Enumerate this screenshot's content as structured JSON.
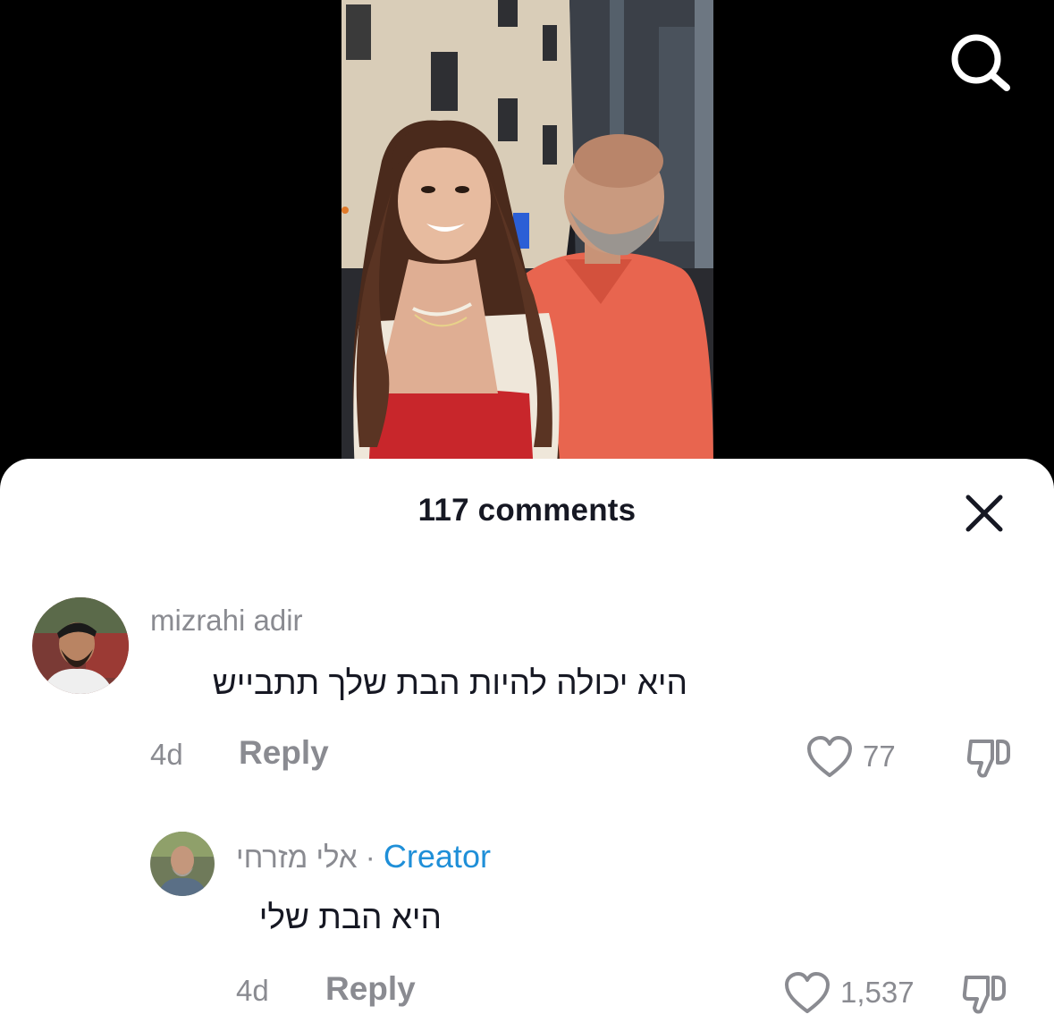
{
  "video": {
    "search_icon": "search-icon"
  },
  "comments_sheet": {
    "title": "117 comments",
    "close_icon": "close-icon"
  },
  "comments": [
    {
      "username": "mizrahi adir",
      "text": "היא יכולה להיות הבת שלך תתבייש",
      "time": "4d",
      "reply_label": "Reply",
      "likes": "77"
    }
  ],
  "replies": [
    {
      "username": "אלי מזרחי",
      "separator": "·",
      "creator_label": "Creator",
      "text": "היא הבת שלי",
      "time": "4d",
      "reply_label": "Reply",
      "likes": "1,537"
    }
  ],
  "colors": {
    "creator": "#1f8fd8",
    "muted": "#8a8b91",
    "text": "#161823"
  }
}
